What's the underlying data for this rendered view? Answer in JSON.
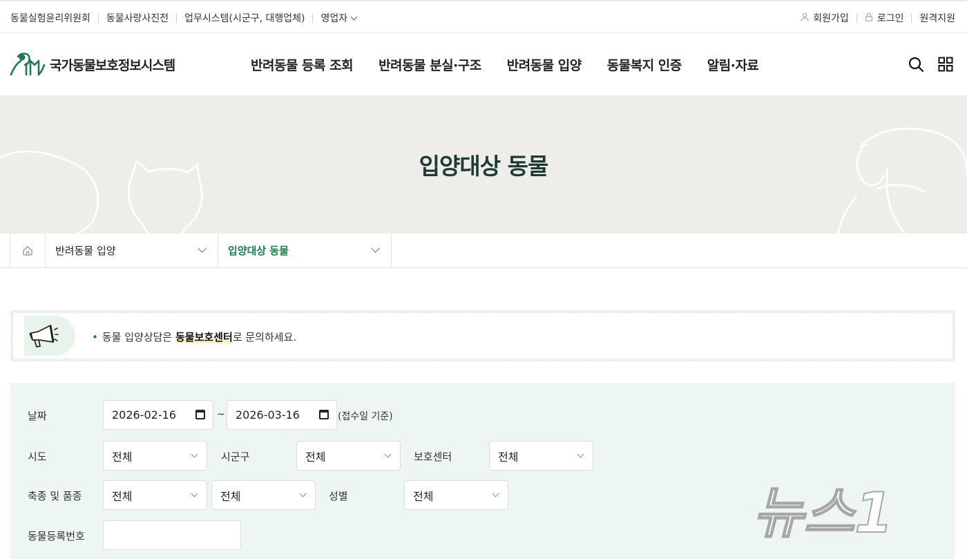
{
  "util": {
    "left_links": [
      "동물실험윤리위원회",
      "동물사랑사진전",
      "업무시스템(시군구, 대행업체)",
      "영업자"
    ],
    "right_links": [
      {
        "label": "회원가입",
        "icon": "person-icon"
      },
      {
        "label": "로그인",
        "icon": "lock-icon"
      },
      {
        "label": "원격지원",
        "icon": ""
      }
    ]
  },
  "header": {
    "logo_text": "국가동물보호정보시스템",
    "menu": [
      "반려동물 등록 조회",
      "반려동물 분실·구조",
      "반려동물 입양",
      "동물복지 인증",
      "알림·자료"
    ]
  },
  "hero": {
    "title": "입양대상 동물"
  },
  "breadcrumb": {
    "level1": "반려동물 입양",
    "level2": "입양대상 동물"
  },
  "notice": {
    "pre": "동물 입양상담은 ",
    "bold": "동물보호센터",
    "post": "로 문의하세요."
  },
  "search": {
    "date_label": "날짜",
    "date_from": "2026-02-16",
    "date_to": "2026-03-16",
    "tilde": "~",
    "date_note": "(접수일 기준)",
    "sido_label": "시도",
    "sido_value": "전체",
    "sigungu_label": "시군구",
    "sigungu_value": "전체",
    "center_label": "보호센터",
    "center_value": "전체",
    "species_label": "축종 및 품종",
    "species_value": "전체",
    "breed_value": "전체",
    "sex_label": "성별",
    "sex_value": "전체",
    "regno_label": "동물등록번호",
    "regno_value": ""
  },
  "watermark": {
    "text": "뉴스1"
  },
  "colors": {
    "accent": "#1d7a4f",
    "hero_bg": "#eeedea",
    "search_bg": "#eef6f1",
    "title": "#1f3a35"
  }
}
